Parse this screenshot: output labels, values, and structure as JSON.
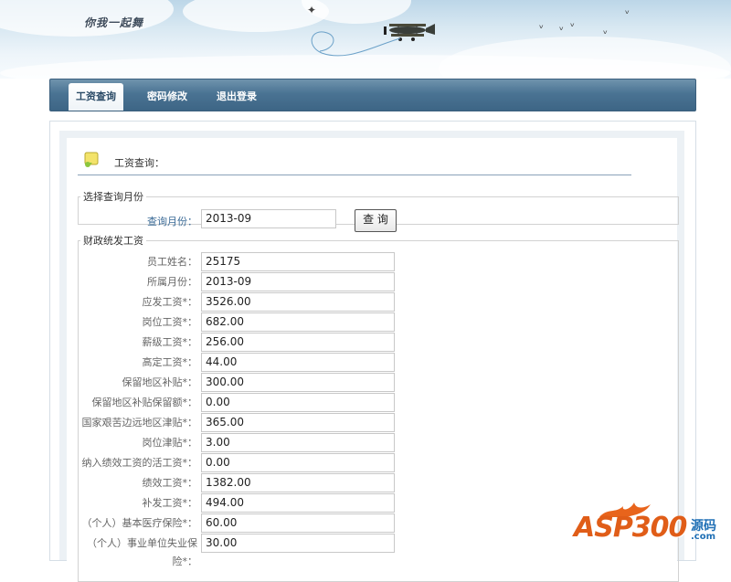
{
  "banner": {
    "logo_text": "你我一起舞"
  },
  "nav": {
    "tabs": [
      {
        "label": "工资查询",
        "active": true
      },
      {
        "label": "密码修改",
        "active": false
      },
      {
        "label": "退出登录",
        "active": false
      }
    ]
  },
  "section": {
    "title": "工资查询："
  },
  "query": {
    "legend": "选择查询月份",
    "label": "查询月份：",
    "value": "2013-09",
    "button_label": "查 询"
  },
  "salary": {
    "legend": "财政统发工资",
    "rows": [
      {
        "label": "员工姓名：",
        "value": "25175"
      },
      {
        "label": "所属月份：",
        "value": "2013-09"
      },
      {
        "label": "应发工资*：",
        "value": "3526.00"
      },
      {
        "label": "岗位工资*：",
        "value": "682.00"
      },
      {
        "label": "薪级工资*：",
        "value": "256.00"
      },
      {
        "label": "高定工资*：",
        "value": "44.00"
      },
      {
        "label": "保留地区补贴*：",
        "value": "300.00"
      },
      {
        "label": "保留地区补贴保留额*：",
        "value": "0.00"
      },
      {
        "label": "国家艰苦边远地区津贴*：",
        "value": "365.00"
      },
      {
        "label": "岗位津贴*：",
        "value": "3.00"
      },
      {
        "label": "纳入绩效工资的活工资*：",
        "value": "0.00"
      },
      {
        "label": "绩效工资*：",
        "value": "1382.00"
      },
      {
        "label": "补发工资*：",
        "value": "494.00"
      },
      {
        "label": "（个人）基本医疗保险*：",
        "value": "60.00"
      },
      {
        "label": "（个人）事业单位失业保险*：",
        "value": "30.00"
      }
    ]
  },
  "watermark": {
    "brand": "ASP300",
    "cn": "源码",
    "domain": ".com"
  },
  "colors": {
    "nav_bar": "#4a7393",
    "label_blue": "#3a6a96",
    "watermark_orange": "#e05d18",
    "watermark_blue": "#1f6fb5"
  }
}
